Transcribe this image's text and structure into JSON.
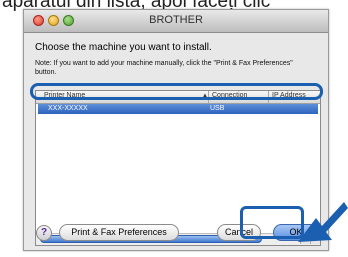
{
  "caption_text": "aparatul din listă, apoi faceți clic",
  "window": {
    "title": "BROTHER"
  },
  "heading": "Choose the machine you want to install.",
  "note": "Note: If you want to add your machine manually, click the \"Print & Fax Preferences\" button.",
  "table": {
    "headers": {
      "name": "Printer Name",
      "connection": "Connection",
      "ip": "IP Address"
    },
    "rows": [
      {
        "name": "XXX-XXXXX",
        "connection": "USB",
        "ip": ""
      }
    ]
  },
  "buttons": {
    "help": "?",
    "print_fax": "Print & Fax Preferences",
    "cancel": "Cancel",
    "ok": "OK"
  },
  "colors": {
    "highlight": "#1b5fb0",
    "selection": "#3a6fd0"
  },
  "icons": [
    "close-icon",
    "minimize-icon",
    "zoom-icon",
    "help-icon",
    "sort-arrow-icon",
    "pointer-arrow-icon"
  ]
}
